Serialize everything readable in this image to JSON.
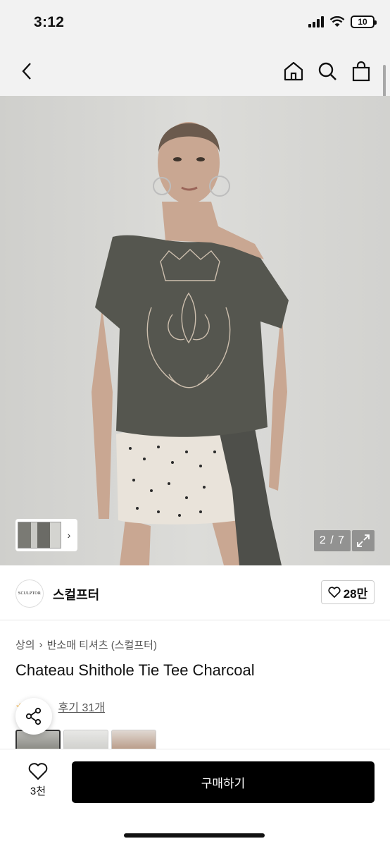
{
  "status": {
    "time": "3:12",
    "battery": "10"
  },
  "nav": {
    "back_icon": "chevron-left-icon",
    "home_icon": "home-icon",
    "search_icon": "search-icon",
    "bag_icon": "shopping-bag-icon"
  },
  "gallery": {
    "counter": "2 / 7",
    "thumb_chevron": "›",
    "current": 2,
    "total": 7
  },
  "brand": {
    "logo_text": "SCULPTOR",
    "name": "스컬프터",
    "likes": "28만"
  },
  "product": {
    "breadcrumb": [
      "상의",
      "반소매 티셔츠 (스컬프터)"
    ],
    "breadcrumb_sep": "›",
    "title": "Chateau Shithole Tie Tee Charcoal",
    "review_label": "후기 31개"
  },
  "bottom": {
    "wish_count": "3천",
    "buy_label": "구매하기"
  },
  "colors": {
    "accent": "#000000",
    "star": "#f5a623"
  }
}
